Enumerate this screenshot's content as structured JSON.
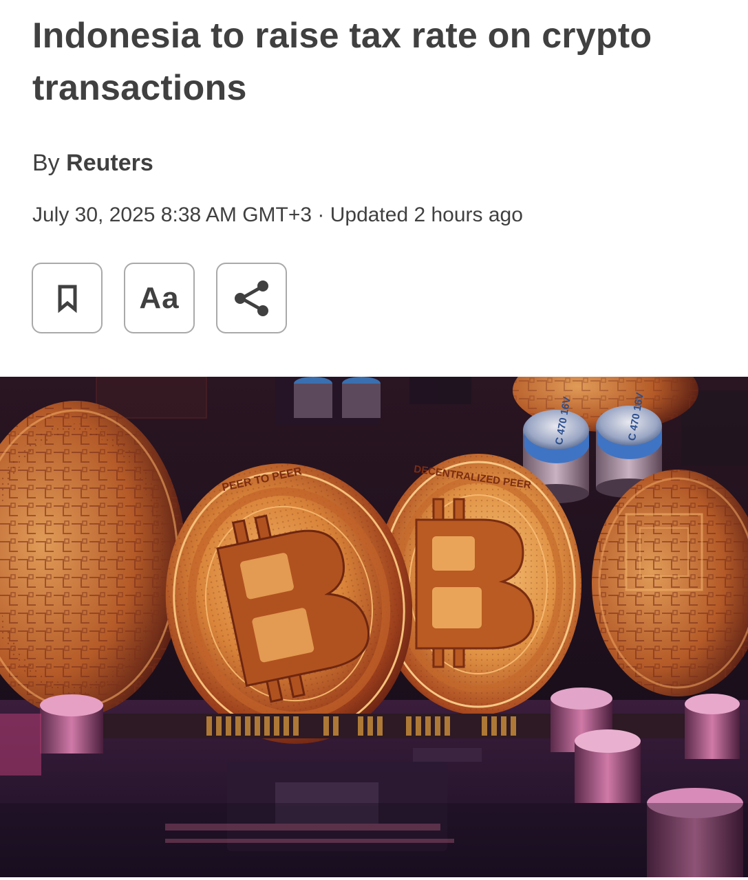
{
  "article": {
    "headline": "Indonesia to raise tax rate on crypto transactions",
    "byline_prefix": "By",
    "author": "Reuters",
    "dateline": "July 30, 2025 8:38 AM GMT+3 · Updated 2 hours ago"
  },
  "toolbar": {
    "bookmark_icon": "bookmark-icon",
    "font_size_label": "Aa",
    "share_icon": "share-icon"
  },
  "hero_image": {
    "subject": "bitcoin-coins-on-circuit-board",
    "coin_rim_text": "PEER TO PEER",
    "coin_rim_text_2": "DECENTRALIZED PEER",
    "capacitor_label_1": "C 470 16V",
    "capacitor_label_2": "C 470 16V"
  },
  "colors": {
    "text": "#404040",
    "button_border": "#a9a9a9",
    "coin_gold": "#d98a3a",
    "background_dark": "#0e0a12"
  }
}
